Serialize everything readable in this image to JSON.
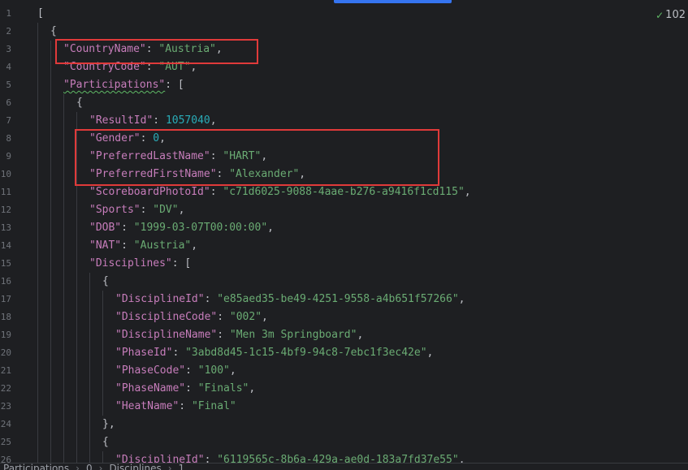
{
  "inspection": {
    "count": "102",
    "icon": "check-icon",
    "color": "#5fb865"
  },
  "editor": {
    "line_numbers": [
      "1",
      "2",
      "3",
      "4",
      "5",
      "6",
      "7",
      "8",
      "9",
      "10",
      "11",
      "12",
      "13",
      "14",
      "15",
      "16",
      "17",
      "18",
      "19",
      "20",
      "21",
      "22",
      "23",
      "24",
      "25",
      "26"
    ],
    "lines": [
      {
        "indent": 0,
        "key": "",
        "sep": "",
        "value": "",
        "vtype": "",
        "trail": "["
      },
      {
        "indent": 1,
        "key": "",
        "sep": "",
        "value": "",
        "vtype": "",
        "trail": "{"
      },
      {
        "indent": 2,
        "key": "\"CountryName\"",
        "sep": ": ",
        "value": "\"Austria\"",
        "vtype": "s",
        "trail": ","
      },
      {
        "indent": 2,
        "key": "\"CountryCode\"",
        "sep": ": ",
        "value": "\"AUT\"",
        "vtype": "s",
        "trail": ","
      },
      {
        "indent": 2,
        "key": "\"Participations\"",
        "sep": ": ",
        "value": "",
        "vtype": "",
        "trail": "[",
        "squiggle": true
      },
      {
        "indent": 3,
        "key": "",
        "sep": "",
        "value": "",
        "vtype": "",
        "trail": "{"
      },
      {
        "indent": 4,
        "key": "\"ResultId\"",
        "sep": ": ",
        "value": "1057040",
        "vtype": "n",
        "trail": ","
      },
      {
        "indent": 4,
        "key": "\"Gender\"",
        "sep": ": ",
        "value": "0",
        "vtype": "n",
        "trail": ","
      },
      {
        "indent": 4,
        "key": "\"PreferredLastName\"",
        "sep": ": ",
        "value": "\"HART\"",
        "vtype": "s",
        "trail": ","
      },
      {
        "indent": 4,
        "key": "\"PreferredFirstName\"",
        "sep": ": ",
        "value": "\"Alexander\"",
        "vtype": "s",
        "trail": ","
      },
      {
        "indent": 4,
        "key": "\"ScoreboardPhotoId\"",
        "sep": ": ",
        "value": "\"c71d6025-9088-4aae-b276-a9416f1cd115\"",
        "vtype": "s",
        "trail": ","
      },
      {
        "indent": 4,
        "key": "\"Sports\"",
        "sep": ": ",
        "value": "\"DV\"",
        "vtype": "s",
        "trail": ","
      },
      {
        "indent": 4,
        "key": "\"DOB\"",
        "sep": ": ",
        "value": "\"1999-03-07T00:00:00\"",
        "vtype": "s",
        "trail": ","
      },
      {
        "indent": 4,
        "key": "\"NAT\"",
        "sep": ": ",
        "value": "\"Austria\"",
        "vtype": "s",
        "trail": ","
      },
      {
        "indent": 4,
        "key": "\"Disciplines\"",
        "sep": ": ",
        "value": "",
        "vtype": "",
        "trail": "["
      },
      {
        "indent": 5,
        "key": "",
        "sep": "",
        "value": "",
        "vtype": "",
        "trail": "{"
      },
      {
        "indent": 6,
        "key": "\"DisciplineId\"",
        "sep": ": ",
        "value": "\"e85aed35-be49-4251-9558-a4b651f57266\"",
        "vtype": "s",
        "trail": ","
      },
      {
        "indent": 6,
        "key": "\"DisciplineCode\"",
        "sep": ": ",
        "value": "\"002\"",
        "vtype": "s",
        "trail": ","
      },
      {
        "indent": 6,
        "key": "\"DisciplineName\"",
        "sep": ": ",
        "value": "\"Men 3m Springboard\"",
        "vtype": "s",
        "trail": ","
      },
      {
        "indent": 6,
        "key": "\"PhaseId\"",
        "sep": ": ",
        "value": "\"3abd8d45-1c15-4bf9-94c8-7ebc1f3ec42e\"",
        "vtype": "s",
        "trail": ","
      },
      {
        "indent": 6,
        "key": "\"PhaseCode\"",
        "sep": ": ",
        "value": "\"100\"",
        "vtype": "s",
        "trail": ","
      },
      {
        "indent": 6,
        "key": "\"PhaseName\"",
        "sep": ": ",
        "value": "\"Finals\"",
        "vtype": "s",
        "trail": ","
      },
      {
        "indent": 6,
        "key": "\"HeatName\"",
        "sep": ": ",
        "value": "\"Final\"",
        "vtype": "s",
        "trail": ""
      },
      {
        "indent": 5,
        "key": "",
        "sep": "",
        "value": "",
        "vtype": "",
        "trail": "},"
      },
      {
        "indent": 5,
        "key": "",
        "sep": "",
        "value": "",
        "vtype": "",
        "trail": "{"
      },
      {
        "indent": 6,
        "key": "\"DisciplineId\"",
        "sep": ": ",
        "value": "\"6119565c-8b6a-429a-ae0d-183a7fd37e55\"",
        "vtype": "s",
        "trail": ","
      }
    ]
  },
  "breadcrumb": {
    "items": [
      "Participations",
      "0",
      "Disciplines",
      "1"
    ]
  },
  "colors": {
    "background": "#1e1f22",
    "key": "#c77dbb",
    "string": "#6aab73",
    "number": "#2aacb8",
    "punctuation": "#bcbec4",
    "highlight_box": "#e03a3a",
    "scroll_thumb": "#3574f0"
  }
}
